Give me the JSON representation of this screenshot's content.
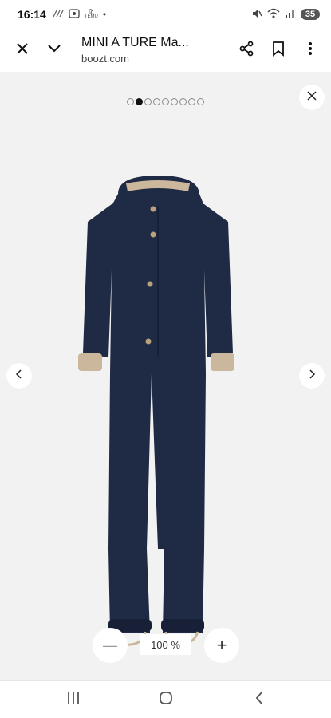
{
  "status_bar": {
    "time": "16:14",
    "left_icons": [
      "wifi-calling-icon",
      "screenshot-icon",
      "temu-app-icon",
      "notification-dot-icon"
    ],
    "temu_label": "TEMU",
    "right_icons": [
      "mute-icon",
      "wifi-icon",
      "signal-icon"
    ],
    "battery": "35"
  },
  "browser": {
    "title": "MINI A TURE Ma...",
    "domain": "boozt.com",
    "icons": {
      "close": "close-icon",
      "chevron": "chevron-down-icon",
      "share": "share-icon",
      "bookmark": "bookmark-icon",
      "menu": "more-vert-icon"
    }
  },
  "gallery": {
    "total_images": 9,
    "current_index": 1,
    "product_alt": "Navy snowsuit with hood and beige cuffs",
    "colors": {
      "background": "#f2f2f2",
      "suit": "#1f2a44",
      "cuff": "#cbb89c"
    }
  },
  "zoom": {
    "level": "100 %",
    "minus_symbol": "—",
    "plus_symbol": "+"
  },
  "nav": {
    "recents_icon": "recents-icon",
    "home_icon": "home-icon",
    "back_icon": "back-icon"
  }
}
